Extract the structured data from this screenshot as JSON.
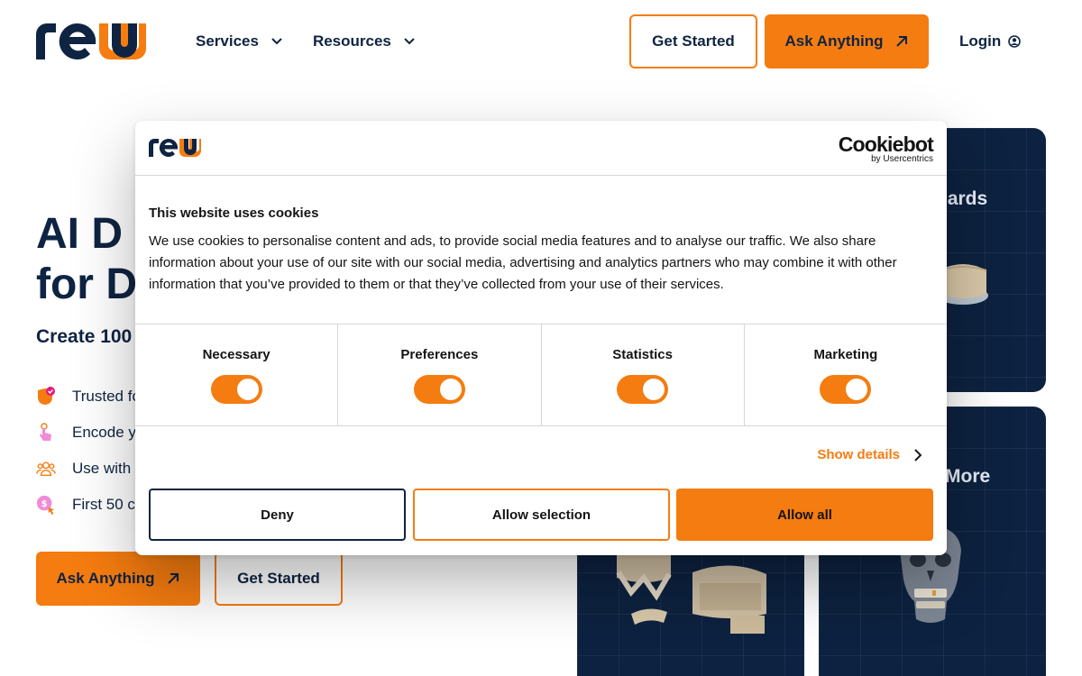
{
  "colors": {
    "accent": "#f57c10",
    "navy": "#0f2442",
    "card_bg": "#0d2240"
  },
  "header": {
    "logo_alt": "rew",
    "nav": [
      {
        "label": "Services",
        "icon": "chevron-down-icon"
      },
      {
        "label": "Resources",
        "icon": "chevron-down-icon"
      }
    ],
    "get_started": "Get Started",
    "ask_anything": "Ask Anything",
    "login": "Login"
  },
  "hero": {
    "title": "AI D\nfor D",
    "subtitle": "Create 100",
    "features": [
      {
        "text": "Trusted fo",
        "icon": "shield-heart-icon"
      },
      {
        "text": "Encode y",
        "icon": "tap-finger-icon"
      },
      {
        "text": "Use with t",
        "icon": "team-icon"
      },
      {
        "text": "First 50 c",
        "icon": "coin-cursor-icon"
      }
    ],
    "ask_anything": "Ask Anything",
    "get_started": "Get Started"
  },
  "cards": [
    {
      "title": "uards"
    },
    {
      "title": "More"
    }
  ],
  "cookie_modal": {
    "brand": "Cookiebot",
    "brand_sub": "by Usercentrics",
    "heading": "This website uses cookies",
    "text": "We use cookies to personalise content and ads, to provide social media features and to analyse our traffic. We also share information about your use of our site with our social media, advertising and analytics partners who may combine it with other information that you’ve provided to them or that they’ve collected from your use of their services.",
    "toggles": [
      {
        "label": "Necessary",
        "checked": true
      },
      {
        "label": "Preferences",
        "checked": true
      },
      {
        "label": "Statistics",
        "checked": true
      },
      {
        "label": "Marketing",
        "checked": true
      }
    ],
    "show_details": "Show details",
    "deny": "Deny",
    "allow_selection": "Allow selection",
    "allow_all": "Allow all"
  }
}
